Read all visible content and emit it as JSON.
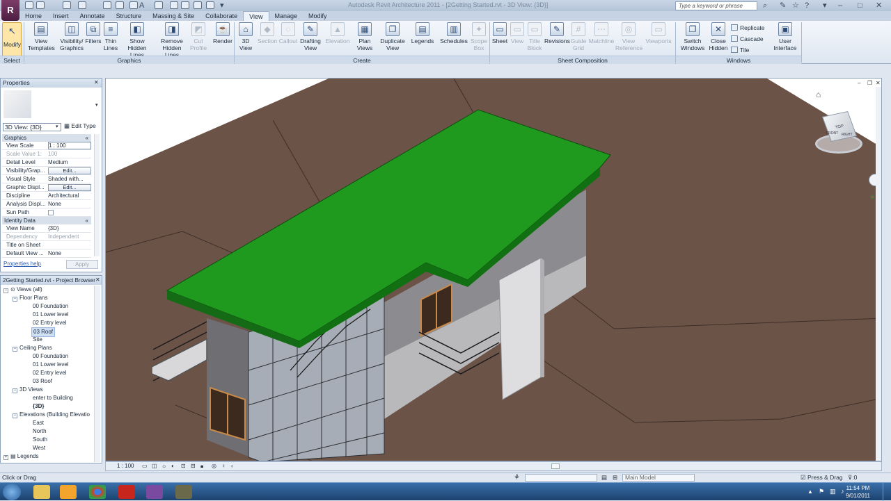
{
  "window": {
    "app_logo": "R",
    "title": "Autodesk Revit Architecture 2011 - [2Getting Started.rvt - 3D View: {3D}]",
    "search_placeholder": "Type a keyword or phrase"
  },
  "tabs": [
    "Home",
    "Insert",
    "Annotate",
    "Structure",
    "Massing & Site",
    "Collaborate",
    "View",
    "Manage",
    "Modify"
  ],
  "active_tab": "View",
  "ribbon": {
    "modify": "Modify",
    "select_panel": "Select",
    "graphics_panel": "Graphics",
    "create_panel": "Create",
    "sheet_panel": "Sheet Composition",
    "windows_panel": "Windows",
    "graphics": [
      {
        "l1": "View",
        "l2": "Templates"
      },
      {
        "l1": "Visibility/",
        "l2": "Graphics"
      },
      {
        "l1": "Filters",
        "l2": ""
      },
      {
        "l1": "Thin",
        "l2": "Lines"
      },
      {
        "l1": "Show",
        "l2": "Hidden Lines"
      },
      {
        "l1": "Remove",
        "l2": "Hidden Lines"
      },
      {
        "l1": "Cut",
        "l2": "Profile"
      }
    ],
    "create": [
      {
        "l1": "Render",
        "l2": ""
      },
      {
        "l1": "3D",
        "l2": "View"
      },
      {
        "l1": "Section",
        "l2": ""
      },
      {
        "l1": "Callout",
        "l2": ""
      },
      {
        "l1": "Drafting",
        "l2": "View"
      },
      {
        "l1": "Elevation",
        "l2": ""
      },
      {
        "l1": "Plan",
        "l2": "Views"
      },
      {
        "l1": "Duplicate",
        "l2": "View"
      },
      {
        "l1": "Legends",
        "l2": ""
      },
      {
        "l1": "Schedules",
        "l2": ""
      },
      {
        "l1": "Scope",
        "l2": "Box"
      }
    ],
    "sheet": [
      {
        "l1": "Sheet",
        "l2": ""
      },
      {
        "l1": "View",
        "l2": ""
      },
      {
        "l1": "Title",
        "l2": "Block"
      },
      {
        "l1": "Revisions",
        "l2": ""
      },
      {
        "l1": "Guide",
        "l2": "Grid"
      },
      {
        "l1": "Matchline",
        "l2": ""
      },
      {
        "l1": "View",
        "l2": "Reference"
      },
      {
        "l1": "Viewports",
        "l2": ""
      }
    ],
    "windows": [
      {
        "l1": "Switch",
        "l2": "Windows"
      },
      {
        "l1": "Close",
        "l2": "Hidden"
      }
    ],
    "replicate": "Replicate",
    "cascade": "Cascade",
    "tile": "Tile",
    "user_interface": {
      "l1": "User",
      "l2": "Interface"
    }
  },
  "properties": {
    "title": "Properties",
    "type": "3D View: {3D}",
    "edit_type": "Edit Type",
    "groups": {
      "graphics": "Graphics",
      "identity": "Identity Data"
    },
    "rows": {
      "view_scale": {
        "k": "View Scale",
        "v": "1 : 100"
      },
      "scale_value": {
        "k": "Scale Value  1:",
        "v": "100"
      },
      "detail_level": {
        "k": "Detail Level",
        "v": "Medium"
      },
      "visibility": {
        "k": "Visibility/Grap...",
        "v": "Edit..."
      },
      "visual_style": {
        "k": "Visual Style",
        "v": "Shaded with..."
      },
      "graphic_display": {
        "k": "Graphic Displ...",
        "v": "Edit..."
      },
      "discipline": {
        "k": "Discipline",
        "v": "Architectural"
      },
      "analysis_display": {
        "k": "Analysis Displ...",
        "v": "None"
      },
      "sun_path": {
        "k": "Sun Path",
        "v": ""
      },
      "view_name": {
        "k": "View Name",
        "v": "{3D}"
      },
      "dependency": {
        "k": "Dependency",
        "v": "Independent"
      },
      "title_on_sheet": {
        "k": "Title on Sheet",
        "v": ""
      },
      "default_view": {
        "k": "Default View ...",
        "v": "None"
      }
    },
    "help": "Properties help",
    "apply": "Apply"
  },
  "browser": {
    "title": "2Getting Started.rvt - Project Browser",
    "views_all": "Views (all)",
    "floor_plans": "Floor Plans",
    "fp_items": [
      "00 Foundation",
      "01 Lower level",
      "02 Entry level",
      "03 Roof",
      "Site"
    ],
    "ceiling_plans": "Ceiling Plans",
    "cp_items": [
      "00 Foundation",
      "01 Lower level",
      "02 Entry level",
      "03 Roof"
    ],
    "views_3d": "3D Views",
    "v3d_items": [
      "enter to Building",
      "{3D}"
    ],
    "elevations": "Elevations (Building Elevatio",
    "el_items": [
      "East",
      "North",
      "South",
      "West"
    ],
    "legends": "Legends"
  },
  "viewbar": {
    "scale": "1 : 100"
  },
  "viewcube": {
    "front": "FRONT",
    "right": "RIGHT",
    "top": "TOP"
  },
  "status": {
    "message": "Click or Drag",
    "model": "Main Model",
    "press_drag": "Press & Drag",
    "filter_count": ":0"
  },
  "taskbar": {
    "time": "11:54 PM",
    "date": "9/01/2011"
  },
  "colors": {
    "roof": "#1f9a1f",
    "terrain": "#6b5348",
    "wall": "#8a8a8e",
    "accent_tab": "#eef3f9"
  }
}
